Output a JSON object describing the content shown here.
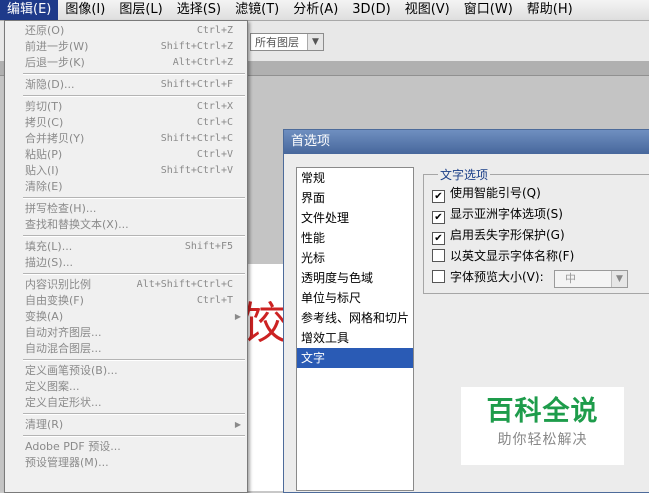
{
  "menubar": [
    {
      "label": "编辑(E)",
      "active": true
    },
    {
      "label": "图像(I)"
    },
    {
      "label": "图层(L)"
    },
    {
      "label": "选择(S)"
    },
    {
      "label": "滤镜(T)"
    },
    {
      "label": "分析(A)"
    },
    {
      "label": "3D(D)"
    },
    {
      "label": "视图(V)"
    },
    {
      "label": "窗口(W)"
    },
    {
      "label": "帮助(H)"
    }
  ],
  "options_bar": {
    "layer_select": "所有图层"
  },
  "edit_menu": [
    {
      "label": "还原(O)",
      "shortcut": "Ctrl+Z"
    },
    {
      "label": "前进一步(W)",
      "shortcut": "Shift+Ctrl+Z"
    },
    {
      "label": "后退一步(K)",
      "shortcut": "Alt+Ctrl+Z"
    },
    {
      "sep": true
    },
    {
      "label": "渐隐(D)...",
      "shortcut": "Shift+Ctrl+F"
    },
    {
      "sep": true
    },
    {
      "label": "剪切(T)",
      "shortcut": "Ctrl+X"
    },
    {
      "label": "拷贝(C)",
      "shortcut": "Ctrl+C"
    },
    {
      "label": "合并拷贝(Y)",
      "shortcut": "Shift+Ctrl+C"
    },
    {
      "label": "粘贴(P)",
      "shortcut": "Ctrl+V"
    },
    {
      "label": "贴入(I)",
      "shortcut": "Shift+Ctrl+V"
    },
    {
      "label": "清除(E)",
      "shortcut": ""
    },
    {
      "sep": true
    },
    {
      "label": "拼写检查(H)...",
      "shortcut": ""
    },
    {
      "label": "查找和替换文本(X)...",
      "shortcut": ""
    },
    {
      "sep": true
    },
    {
      "label": "填充(L)...",
      "shortcut": "Shift+F5"
    },
    {
      "label": "描边(S)...",
      "shortcut": ""
    },
    {
      "sep": true
    },
    {
      "label": "内容识别比例",
      "shortcut": "Alt+Shift+Ctrl+C"
    },
    {
      "label": "自由变换(F)",
      "shortcut": "Ctrl+T"
    },
    {
      "label": "变换(A)",
      "shortcut": "",
      "submenu": true
    },
    {
      "label": "自动对齐图层...",
      "shortcut": ""
    },
    {
      "label": "自动混合图层...",
      "shortcut": ""
    },
    {
      "sep": true
    },
    {
      "label": "定义画笔预设(B)...",
      "shortcut": ""
    },
    {
      "label": "定义图案...",
      "shortcut": ""
    },
    {
      "label": "定义自定形状...",
      "shortcut": ""
    },
    {
      "sep": true
    },
    {
      "label": "清理(R)",
      "shortcut": "",
      "submenu": true
    },
    {
      "sep": true
    },
    {
      "label": "Adobe PDF 预设...",
      "shortcut": ""
    },
    {
      "label": "预设管理器(M)...",
      "shortcut": ""
    }
  ],
  "dialog": {
    "title": "首选项",
    "categories": [
      {
        "label": "常规"
      },
      {
        "label": "界面"
      },
      {
        "label": "文件处理"
      },
      {
        "label": "性能"
      },
      {
        "label": "光标"
      },
      {
        "label": "透明度与色域"
      },
      {
        "label": "单位与标尺"
      },
      {
        "label": "参考线、网格和切片"
      },
      {
        "label": "增效工具"
      },
      {
        "label": "文字",
        "selected": true
      }
    ],
    "group_title": "文字选项",
    "options": [
      {
        "label": "使用智能引号(Q)",
        "checked": true
      },
      {
        "label": "显示亚洲字体选项(S)",
        "checked": true
      },
      {
        "label": "启用丢失字形保护(G)",
        "checked": true
      },
      {
        "label": "以英文显示字体名称(F)",
        "checked": false
      },
      {
        "label": "字体预览大小(V):",
        "checked": false,
        "select": "中"
      }
    ]
  },
  "doc_char": "饺",
  "watermark": {
    "title": "百科全说",
    "subtitle": "助你轻松解决"
  }
}
